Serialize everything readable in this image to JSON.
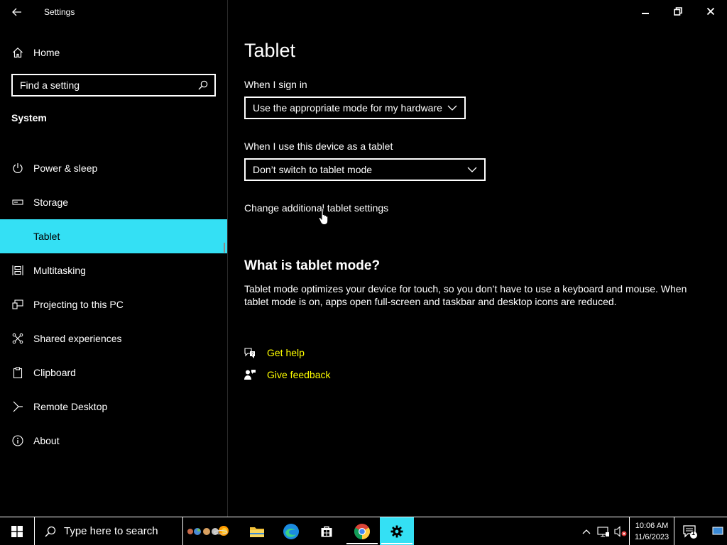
{
  "window": {
    "title": "Settings",
    "controls": {
      "minimize": "—",
      "restore": "❐",
      "close": "✕"
    }
  },
  "sidebar": {
    "home_label": "Home",
    "search_placeholder": "Find a setting",
    "group_label": "System",
    "items": [
      {
        "label": "Power & sleep",
        "icon": "power-icon",
        "selected": false
      },
      {
        "label": "Storage",
        "icon": "storage-icon",
        "selected": false
      },
      {
        "label": "Tablet",
        "icon": "tablet-icon",
        "selected": true
      },
      {
        "label": "Multitasking",
        "icon": "multitasking-icon",
        "selected": false
      },
      {
        "label": "Projecting to this PC",
        "icon": "projecting-icon",
        "selected": false
      },
      {
        "label": "Shared experiences",
        "icon": "shared-experiences-icon",
        "selected": false
      },
      {
        "label": "Clipboard",
        "icon": "clipboard-icon",
        "selected": false
      },
      {
        "label": "Remote Desktop",
        "icon": "remote-desktop-icon",
        "selected": false
      },
      {
        "label": "About",
        "icon": "info-icon",
        "selected": false
      }
    ]
  },
  "main": {
    "title": "Tablet",
    "sign_in_label": "When I sign in",
    "sign_in_value": "Use the appropriate mode for my hardware",
    "tablet_use_label": "When I use this device as a tablet",
    "tablet_use_value": "Don’t switch to tablet mode",
    "additional_link": "Change additional tablet settings",
    "section_title": "What is tablet mode?",
    "description": "Tablet mode optimizes your device for touch, so you don’t have to use a keyboard and mouse. When tablet mode is on, apps open full-screen and taskbar and desktop icons are reduced.",
    "get_help": "Get help",
    "give_feedback": "Give feedback"
  },
  "taskbar": {
    "search_placeholder": "Type here to search",
    "time": "10:06 AM",
    "date": "11/6/2023",
    "notification_count": "1"
  },
  "colors": {
    "accent": "#34e0f4",
    "link_yellow": "#ffff00",
    "background": "#000000",
    "text": "#ffffff"
  }
}
